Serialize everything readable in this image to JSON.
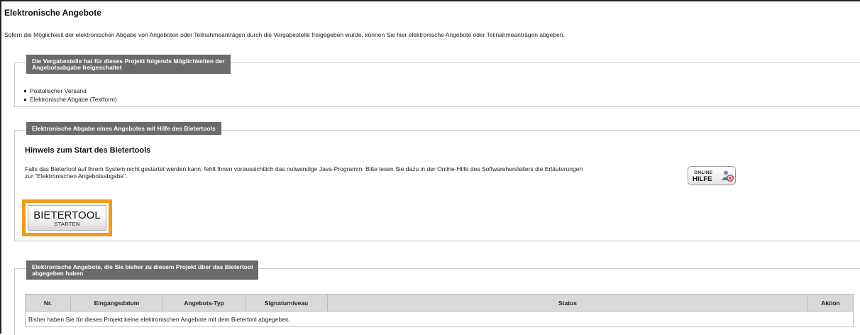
{
  "page": {
    "title": "Elektronische Angebote",
    "intro": "Sofern die Möglichkeit der elektronischen Abgabe von Angeboten oder Teilnahmeanträgen durch die Vergabestelle freigegeben wurde, können Sie hier elektronische Angebote oder Teilnahmeanträgen abgeben."
  },
  "options_panel": {
    "legend_line1": "Die Vergabestelle hat für dieses Projekt folgende Möglichkeiten der",
    "legend_line2": "Angebotsabgabe freigeschaltet",
    "items": [
      "Postalischer Versand",
      "Elektronische Abgabe (Textform)"
    ]
  },
  "tool_panel": {
    "legend": "Elektronische Abgabe eines Angebotes mit Hilfe des Bietertools",
    "hint_heading": "Hinweis zum Start des Bietertools",
    "hint_line1": "Falls das Bietertool auf Ihrem System nicht gestartet werden kann, fehlt Ihnen voraussichtlich das notwendige Java-Programm. Bitte lesen Sie dazu in der Online-Hilfe des Softwareherstellers die Erläuterungen",
    "hint_line2": "zur \"Elektronischen Angebotsabgabe\".",
    "help_button": {
      "line1": "ONLINE",
      "line2": "HILFE",
      "icon": "help-person-icon"
    },
    "start_button": {
      "line1": "BIETERTOOL",
      "line2": "STARTEN"
    }
  },
  "bids_panel": {
    "legend_line1": "Elektronische Angebote, die Sie bisher zu diesem Projekt über das Bietertool",
    "legend_line2": "abgegeben haben",
    "columns": [
      "Nr.",
      "Eingangsdatum",
      "Angebots-Typ",
      "Signaturniveau",
      "Status",
      "Aktion"
    ],
    "empty_message": "Bisher haben Sie für dieses Projekt keine elektronischen Angebote mit dem Bietertool abgegeben."
  },
  "colors": {
    "legend_bg": "#6b6b6b",
    "highlight_border": "#f39a1a",
    "table_header_bg": "#d9d9d9"
  }
}
